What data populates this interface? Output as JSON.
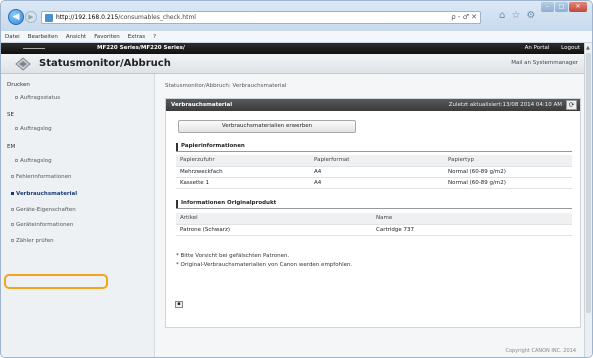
{
  "browser": {
    "url_host": "http://192.168.0.215",
    "url_path": "/consumables_check.html",
    "addr_tools": "ρ - ♂ ✕",
    "menu": [
      "Datei",
      "Bearbeiten",
      "Ansicht",
      "Favoriten",
      "Extras",
      "?"
    ]
  },
  "header": {
    "model": "MF220 Series/MF220 Series/",
    "portal": "An Portal",
    "logout": "Logout",
    "title": "Statusmonitor/Abbruch",
    "mail": "Mail an Systemmanager"
  },
  "sidebar": {
    "groups": [
      {
        "label": "Drucken",
        "sub": "Auftragsstatus"
      },
      {
        "label": "SE",
        "sub": "Auftragslog"
      },
      {
        "label": "EM",
        "sub": "Auftragslog"
      }
    ],
    "links": [
      "Fehlerinformationen",
      "Verbrauchsmaterial",
      "Geräte-Eigenschaften",
      "Geräteinformationen",
      "Zähler prüfen"
    ]
  },
  "main": {
    "breadcrumb": "Statusmonitor/Abbruch: Verbrauchsmaterial",
    "panel_title": "Verbrauchsmaterial",
    "last_updated": "Zuletzt aktualisiert:13/08 2014 04:10 AM",
    "buy_button": "Verbrauchsmaterialien erwerben",
    "paper_section": "Papierinformationen",
    "paper_headers": [
      "Papierzufuhr",
      "Papierformat",
      "Papiertyp"
    ],
    "paper_rows": [
      [
        "Mehrzweckfach",
        "A4",
        "Normal (60-89 g/m2)"
      ],
      [
        "Kassette 1",
        "A4",
        "Normal (60-89 g/m2)"
      ]
    ],
    "original_section": "Informationen Originalprodukt",
    "original_headers": [
      "Artikel",
      "Name"
    ],
    "original_rows": [
      [
        "Patrone (Schwarz)",
        "Cartridge 737"
      ]
    ],
    "note1": "* Bitte Vorsicht bei gefälschten Patronen.",
    "note2": "* Original-Verbrauchsmaterialien von Canon werden empfohlen."
  },
  "footer": {
    "copyright": "Copyright CANON INC. 2014"
  },
  "colors": {
    "highlight": "#f2a41b",
    "header_dark": "#222222"
  }
}
